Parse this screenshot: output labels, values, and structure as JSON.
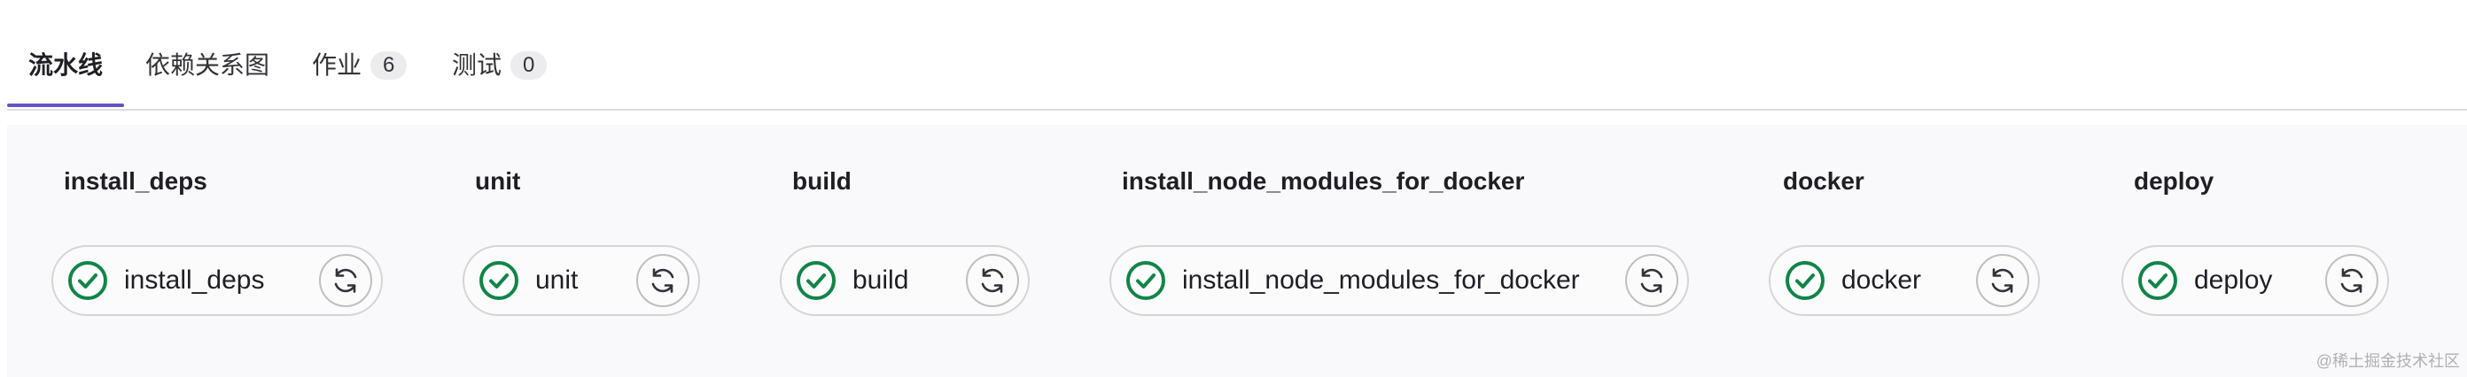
{
  "tabs": [
    {
      "label": "流水线"
    },
    {
      "label": "依赖关系图"
    },
    {
      "label": "作业",
      "count": "6"
    },
    {
      "label": "测试",
      "count": "0"
    }
  ],
  "stages": [
    {
      "title": "install_deps",
      "job": "install_deps",
      "status": "success"
    },
    {
      "title": "unit",
      "job": "unit",
      "status": "success"
    },
    {
      "title": "build",
      "job": "build",
      "status": "success"
    },
    {
      "title": "install_node_modules_for_docker",
      "job": "install_node_modules_for_docker",
      "status": "success"
    },
    {
      "title": "docker",
      "job": "docker",
      "status": "success"
    },
    {
      "title": "deploy",
      "job": "deploy",
      "status": "success"
    }
  ],
  "colors": {
    "success": "#108548",
    "tab_accent": "#6054c6"
  },
  "icons": {
    "status": "check-circle-icon",
    "retry": "retry-icon"
  },
  "watermark": "@稀土掘金技术社区"
}
